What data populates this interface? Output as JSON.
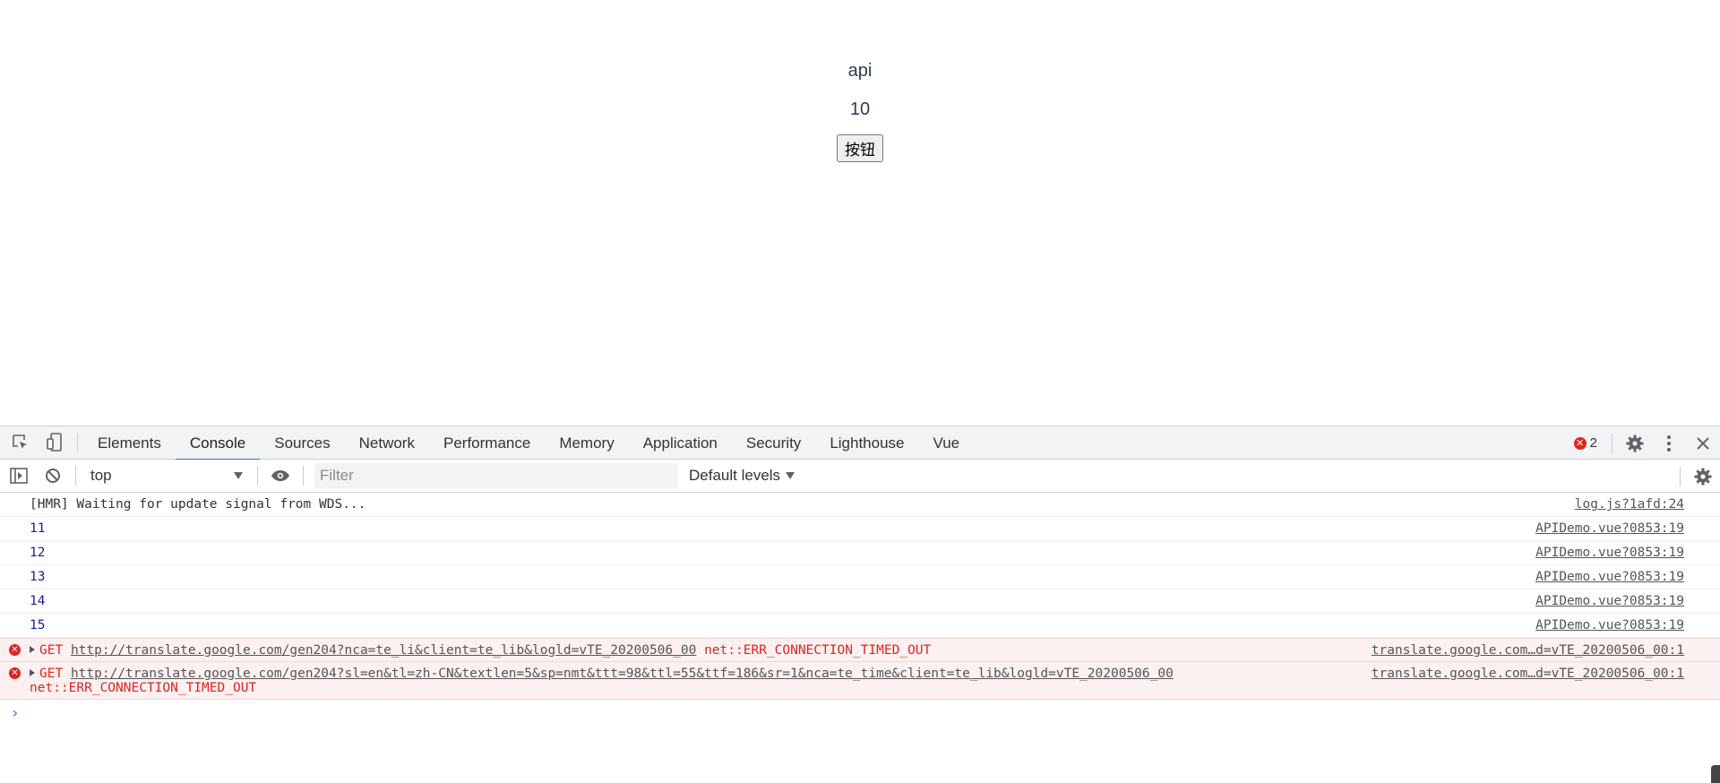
{
  "app": {
    "title": "api",
    "count": "10",
    "button_label": "按钮"
  },
  "devtools": {
    "tabs": [
      {
        "label": "Elements",
        "active": false
      },
      {
        "label": "Console",
        "active": true
      },
      {
        "label": "Sources",
        "active": false
      },
      {
        "label": "Network",
        "active": false
      },
      {
        "label": "Performance",
        "active": false
      },
      {
        "label": "Memory",
        "active": false
      },
      {
        "label": "Application",
        "active": false
      },
      {
        "label": "Security",
        "active": false
      },
      {
        "label": "Lighthouse",
        "active": false
      },
      {
        "label": "Vue",
        "active": false
      }
    ],
    "error_count": "2",
    "toolbar": {
      "context": "top",
      "filter_placeholder": "Filter",
      "levels_label": "Default levels"
    },
    "messages": [
      {
        "text": "[HMR] Waiting for update signal from WDS...",
        "source": "log.js?1afd:24"
      },
      {
        "text": "11",
        "source": "APIDemo.vue?0853:19"
      },
      {
        "text": "12",
        "source": "APIDemo.vue?0853:19"
      },
      {
        "text": "13",
        "source": "APIDemo.vue?0853:19"
      },
      {
        "text": "14",
        "source": "APIDemo.vue?0853:19"
      },
      {
        "text": "15",
        "source": "APIDemo.vue?0853:19"
      }
    ],
    "errors": [
      {
        "method": "GET",
        "url": "http://translate.google.com/gen204?nca=te_li&client=te_lib&logld=vTE_20200506_00",
        "error": "net::ERR_CONNECTION_TIMED_OUT",
        "source": "translate.google.com…d=vTE_20200506_00:1"
      },
      {
        "method": "GET",
        "url": "http://translate.google.com/gen204?sl=en&tl=zh-CN&textlen=5&sp=nmt&ttt=98&ttl=55&ttf=186&sr=1&nca=te_time&client=te_lib&logld=vTE_20200506_00",
        "error": "net::ERR_CONNECTION_TIMED_OUT",
        "source": "translate.google.com…d=vTE_20200506_00:1"
      }
    ],
    "prompt": "›",
    "colors": {
      "accent": "#1a73e8",
      "error": "#e0251e",
      "number": "#1a1aa6"
    }
  }
}
